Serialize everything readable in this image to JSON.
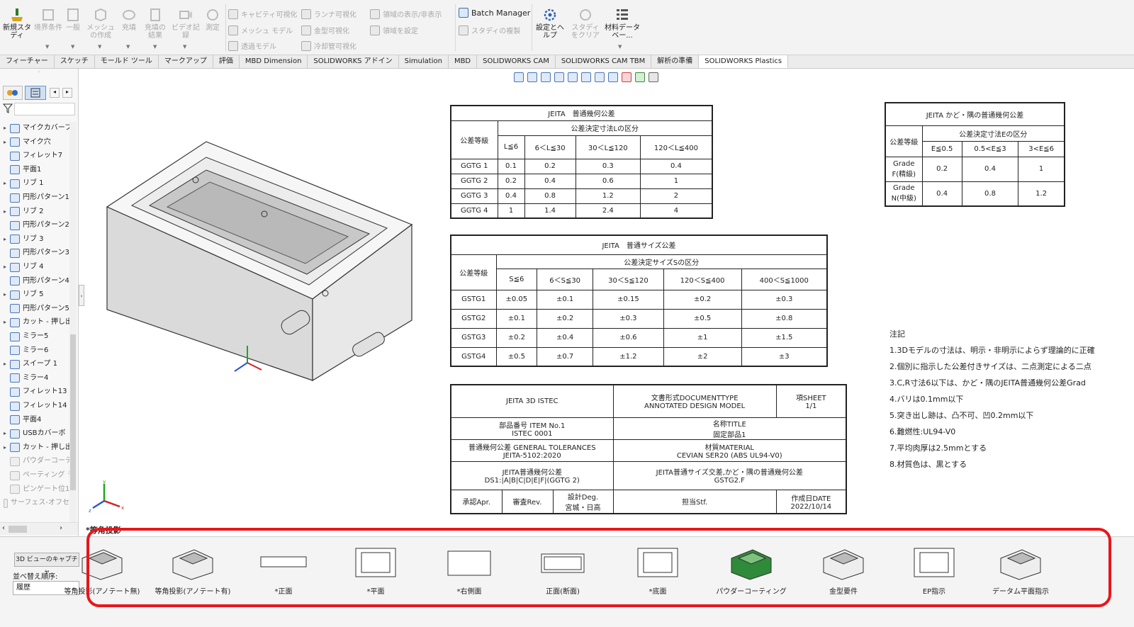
{
  "ribbon": {
    "new_study": "新規スタディ",
    "boundary": "境界条件",
    "general": "一般",
    "mesh_create": "メッシュの作成",
    "fill": "充填",
    "fill_result": "充填の結果",
    "video": "ビデオ記録",
    "measure": "測定",
    "cavity_vis": "キャビティ可視化",
    "mesh_model": "メッシュ モデル",
    "transparent": "透過モデル",
    "runner_vis": "ランナ可視化",
    "mold_vis": "金型可視化",
    "cooling_vis": "冷却管可視化",
    "domain_toggle": "領域の表示/非表示",
    "domain_set": "領域を設定",
    "batch_manager": "Batch Manager",
    "study_copy": "スタディの複製",
    "settings_help": "設定とヘルプ",
    "study_clear": "スタディをクリア",
    "material_db": "材料データベー..."
  },
  "tabs": [
    "フィーチャー",
    "スケッチ",
    "モールド ツール",
    "マークアップ",
    "評価",
    "MBD Dimension",
    "SOLIDWORKS アドイン",
    "Simulation",
    "MBD",
    "SOLIDWORKS CAM",
    "SOLIDWORKS CAM TBM",
    "解析の準備",
    "SOLIDWORKS Plastics"
  ],
  "tree": [
    {
      "label": "マイクカバーフ",
      "exp": true
    },
    {
      "label": "マイク穴",
      "exp": true
    },
    {
      "label": "フィレット7",
      "exp": false
    },
    {
      "label": "平面1",
      "exp": false
    },
    {
      "label": "リブ 1",
      "exp": true
    },
    {
      "label": "円形パターン1",
      "exp": false
    },
    {
      "label": "リブ 2",
      "exp": true
    },
    {
      "label": "円形パターン2",
      "exp": false
    },
    {
      "label": "リブ 3",
      "exp": true
    },
    {
      "label": "円形パターン3",
      "exp": false
    },
    {
      "label": "リブ 4",
      "exp": true
    },
    {
      "label": "円形パターン4",
      "exp": false
    },
    {
      "label": "リブ 5",
      "exp": true
    },
    {
      "label": "円形パターン5",
      "exp": false
    },
    {
      "label": "カット - 押し出",
      "exp": true
    },
    {
      "label": "ミラー5",
      "exp": false
    },
    {
      "label": "ミラー6",
      "exp": false
    },
    {
      "label": "スイープ 1",
      "exp": true
    },
    {
      "label": "ミラー4",
      "exp": false
    },
    {
      "label": "フィレット13",
      "exp": false
    },
    {
      "label": "フィレット14",
      "exp": false
    },
    {
      "label": "平面4",
      "exp": false
    },
    {
      "label": "USBカバーボ",
      "exp": true
    },
    {
      "label": "カット - 押し出",
      "exp": true
    },
    {
      "label": "パウダーコーテ",
      "exp": false,
      "dim": true
    },
    {
      "label": "ペーティング ラ",
      "exp": false,
      "dim": true
    },
    {
      "label": "ピンゲート位1",
      "exp": false,
      "dim": true
    },
    {
      "label": "サーフェス-オフセッ",
      "exp": false,
      "dim": true
    }
  ],
  "ggtg": {
    "title": "JEITA　普通幾何公差",
    "grade": "公差等級",
    "group": "公差決定寸法Lの区分",
    "cols": [
      "L≦6",
      "6＜L≦30",
      "30＜L≦120",
      "120＜L≦400"
    ],
    "rows": [
      [
        "GGTG 1",
        "0.1",
        "0.2",
        "0.3",
        "0.4"
      ],
      [
        "GGTG 2",
        "0.2",
        "0.4",
        "0.6",
        "1"
      ],
      [
        "GGTG 3",
        "0.4",
        "0.8",
        "1.2",
        "2"
      ],
      [
        "GGTG 4",
        "1",
        "1.4",
        "2.4",
        "4"
      ]
    ]
  },
  "gstg": {
    "title": "JEITA　普通サイズ公差",
    "grade": "公差等級",
    "group": "公差決定サイズSの区分",
    "cols": [
      "S≦6",
      "6＜S≦30",
      "30＜S≦120",
      "120＜S≦400",
      "400＜S≦1000"
    ],
    "rows": [
      [
        "GSTG1",
        "±0.05",
        "±0.1",
        "±0.15",
        "±0.2",
        "±0.3"
      ],
      [
        "GSTG2",
        "±0.1",
        "±0.2",
        "±0.3",
        "±0.5",
        "±0.8"
      ],
      [
        "GSTG3",
        "±0.2",
        "±0.4",
        "±0.6",
        "±1",
        "±1.5"
      ],
      [
        "GSTG4",
        "±0.5",
        "±0.7",
        "±1.2",
        "±2",
        "±3"
      ]
    ]
  },
  "corner": {
    "title": "JEITA かど・隅の普通幾何公差",
    "grade": "公差等級",
    "group": "公差決定寸法Eの区分",
    "cols": [
      "E≦0.5",
      "0.5<E≦3",
      "3<E≦6"
    ],
    "rows": [
      [
        "Grade F(精級)",
        "0.2",
        "0.4",
        "1"
      ],
      [
        "Grade N(中級)",
        "0.4",
        "0.8",
        "1.2"
      ]
    ]
  },
  "titleblock": {
    "org": "JEITA 3D ISTEC",
    "doctype_a": "文書形式DOCUMENTTYPE",
    "doctype_b": "ANNOTATED DESIGN MODEL",
    "sheet_a": "項SHEET",
    "sheet_b": "1/1",
    "item_a": "部品番号 ITEM No.1",
    "item_b": "ISTEC 0001",
    "name_a": "名称TITLE",
    "name_b": "固定部品1",
    "gt_a": "普通幾何公差 GENERAL TOLERANCES",
    "gt_b": "JEITA-5102:2020",
    "mat_a": "材質MATERIAL",
    "mat_b": "CEVIAN SER20 (ABS UL94-V0)",
    "jg_a": "JEITA普通幾何公差",
    "jg_b": "DS1:|A|B|C|D|E|F|(GGTG 2)",
    "js_a": "JEITA普通サイズ交差,かど・隅の普通幾何公差",
    "js_b": "GSTG2.F",
    "apr": "承認Apr.",
    "rev": "審査Rev.",
    "deg_a": "設計Deg.",
    "deg_b": "宮城・日高",
    "stf": "担当Stf.",
    "date_a": "作成日DATE",
    "date_b": "2022/10/14"
  },
  "notes": {
    "title": "注記",
    "lines": [
      "1.3Dモデルの寸法は、明示・非明示によらず理論的に正確",
      "2.個別に指示した公差付きサイズは、二点測定による二点",
      "3.C,R寸法6以下は、かど・隅のJEITA普通幾何公差Grad",
      "4.バリは0.1mm以下",
      "5.突き出し跡は、凸不可、凹0.2mm以下",
      "6.難燃性:UL94-V0",
      "7.平均肉厚は2.5mmとする",
      "8.材質色は、黒とする"
    ]
  },
  "bottom": {
    "section_label": "*等角投影",
    "capture": "3D ビューのキャプチャ",
    "sort_label": "並べ替え順序:",
    "sort_value": "履歴",
    "views": [
      "等角投影(アノテート無)",
      "等角投影(アノテート有)",
      "*正面",
      "*平面",
      "*右側面",
      "正面(断面)",
      "*底面",
      "パウダーコーティング",
      "金型要件",
      "EP指示",
      "データム平面指示"
    ]
  },
  "colors": {
    "highlight": "#e8161b",
    "powder": "#2f8a3a",
    "axis_y": "#1fa51f",
    "axis_x": "#d42020",
    "axis_z": "#2b55d6"
  }
}
